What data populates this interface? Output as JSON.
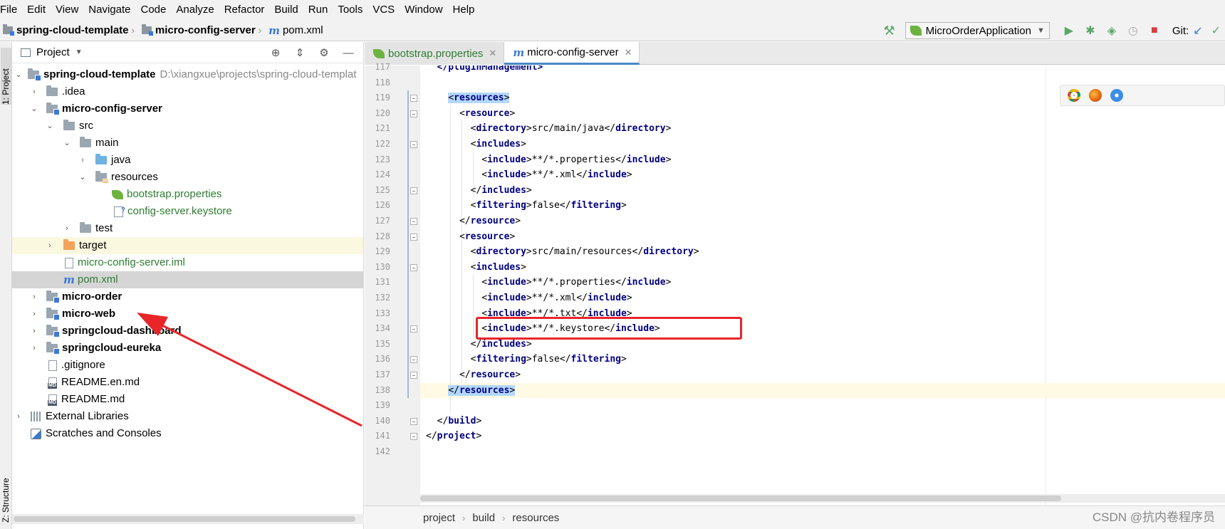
{
  "menu": [
    "File",
    "Edit",
    "View",
    "Navigate",
    "Code",
    "Analyze",
    "Refactor",
    "Build",
    "Run",
    "Tools",
    "VCS",
    "Window",
    "Help"
  ],
  "navbar": {
    "crumbs": [
      "spring-cloud-template",
      "micro-config-server",
      "pom.xml"
    ],
    "run_config": "MicroOrderApplication",
    "git_label": "Git:"
  },
  "side_tabs": {
    "project": "1: Project",
    "structure": "Z: Structure"
  },
  "project_panel": {
    "title": "Project",
    "root_path": "D:\\xiangxue\\projects\\spring-cloud-templat",
    "items": [
      {
        "label": "spring-cloud-template"
      },
      {
        "label": ".idea"
      },
      {
        "label": "micro-config-server"
      },
      {
        "label": "src"
      },
      {
        "label": "main"
      },
      {
        "label": "java"
      },
      {
        "label": "resources"
      },
      {
        "label": "bootstrap.properties"
      },
      {
        "label": "config-server.keystore"
      },
      {
        "label": "test"
      },
      {
        "label": "target"
      },
      {
        "label": "micro-config-server.iml"
      },
      {
        "label": "pom.xml"
      },
      {
        "label": "micro-order"
      },
      {
        "label": "micro-web"
      },
      {
        "label": "springcloud-dashboard"
      },
      {
        "label": "springcloud-eureka"
      },
      {
        "label": ".gitignore"
      },
      {
        "label": "README.en.md"
      },
      {
        "label": "README.md"
      },
      {
        "label": "External Libraries"
      },
      {
        "label": "Scratches and Consoles"
      }
    ]
  },
  "editor": {
    "tabs": [
      "bootstrap.properties",
      "micro-config-server"
    ],
    "line_numbers": [
      "117",
      "118",
      "119",
      "120",
      "121",
      "122",
      "123",
      "124",
      "125",
      "126",
      "127",
      "128",
      "129",
      "130",
      "131",
      "132",
      "133",
      "134",
      "135",
      "136",
      "137",
      "138",
      "139",
      "140",
      "141",
      "142"
    ],
    "partial_top_line": "</pluginManagement>",
    "lines": [
      {
        "no": "118",
        "indent": "",
        "open": "",
        "text": "",
        "close": ""
      },
      {
        "no": "119",
        "indent": "    ",
        "open": "resources",
        "text": "",
        "close": ""
      },
      {
        "no": "120",
        "indent": "      ",
        "open": "resource",
        "text": "",
        "close": ""
      },
      {
        "no": "121",
        "indent": "        ",
        "open": "directory",
        "text": "src/main/java",
        "close": "directory"
      },
      {
        "no": "122",
        "indent": "        ",
        "open": "includes",
        "text": "",
        "close": ""
      },
      {
        "no": "123",
        "indent": "          ",
        "open": "include",
        "text": "**/*.properties",
        "close": "include"
      },
      {
        "no": "124",
        "indent": "          ",
        "open": "include",
        "text": "**/*.xml",
        "close": "include"
      },
      {
        "no": "125",
        "indent": "        ",
        "open": "",
        "text": "",
        "close": "includes"
      },
      {
        "no": "126",
        "indent": "        ",
        "open": "filtering",
        "text": "false",
        "close": "filtering"
      },
      {
        "no": "127",
        "indent": "      ",
        "open": "",
        "text": "",
        "close": "resource"
      },
      {
        "no": "128",
        "indent": "      ",
        "open": "resource",
        "text": "",
        "close": ""
      },
      {
        "no": "129",
        "indent": "        ",
        "open": "directory",
        "text": "src/main/resources",
        "close": "directory"
      },
      {
        "no": "130",
        "indent": "        ",
        "open": "includes",
        "text": "",
        "close": ""
      },
      {
        "no": "131",
        "indent": "          ",
        "open": "include",
        "text": "**/*.properties",
        "close": "include"
      },
      {
        "no": "132",
        "indent": "          ",
        "open": "include",
        "text": "**/*.xml",
        "close": "include"
      },
      {
        "no": "133",
        "indent": "          ",
        "open": "include",
        "text": "**/*.txt",
        "close": "include"
      },
      {
        "no": "134",
        "indent": "          ",
        "open": "include",
        "text": "**/*.keystore",
        "close": "include"
      },
      {
        "no": "135",
        "indent": "        ",
        "open": "",
        "text": "",
        "close": "includes"
      },
      {
        "no": "136",
        "indent": "        ",
        "open": "filtering",
        "text": "false",
        "close": "filtering"
      },
      {
        "no": "137",
        "indent": "      ",
        "open": "",
        "text": "",
        "close": "resource"
      },
      {
        "no": "138",
        "indent": "    ",
        "open": "",
        "text": "",
        "close": "resources"
      },
      {
        "no": "139",
        "indent": "",
        "open": "",
        "text": "",
        "close": ""
      },
      {
        "no": "140",
        "indent": "  ",
        "open": "",
        "text": "",
        "close": "build"
      },
      {
        "no": "141",
        "indent": "",
        "open": "",
        "text": "",
        "close": "project"
      },
      {
        "no": "142",
        "indent": "",
        "open": "",
        "text": "",
        "close": ""
      }
    ],
    "breadcrumb": [
      "project",
      "build",
      "resources"
    ]
  },
  "watermark": "CSDN @抗内卷程序员",
  "colors": {
    "tag": "#000080",
    "highlight": "#b3d7ff",
    "annotation_red": "#e8262a",
    "excluded_row": "#fbf8e0"
  }
}
